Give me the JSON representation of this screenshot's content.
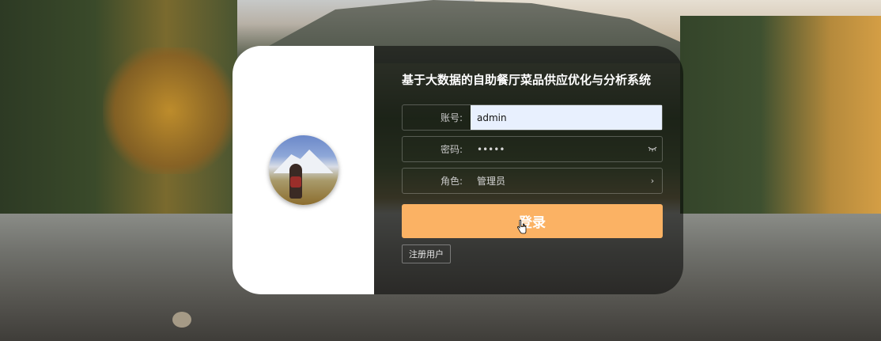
{
  "title": "基于大数据的自助餐厅菜品供应优化与分析系统",
  "form": {
    "account_label": "账号:",
    "account_value": "admin",
    "password_label": "密码:",
    "password_value": "•••••",
    "password_toggle_icon": "eye-closed-icon",
    "role_label": "角色:",
    "role_value": "管理员",
    "role_arrow": "›"
  },
  "buttons": {
    "login": "登录",
    "register": "注册用户"
  },
  "colors": {
    "login_button": "#fbb264",
    "card_panel": "rgba(0,0,0,0.52)",
    "input_autofill": "#e8f0fe"
  }
}
